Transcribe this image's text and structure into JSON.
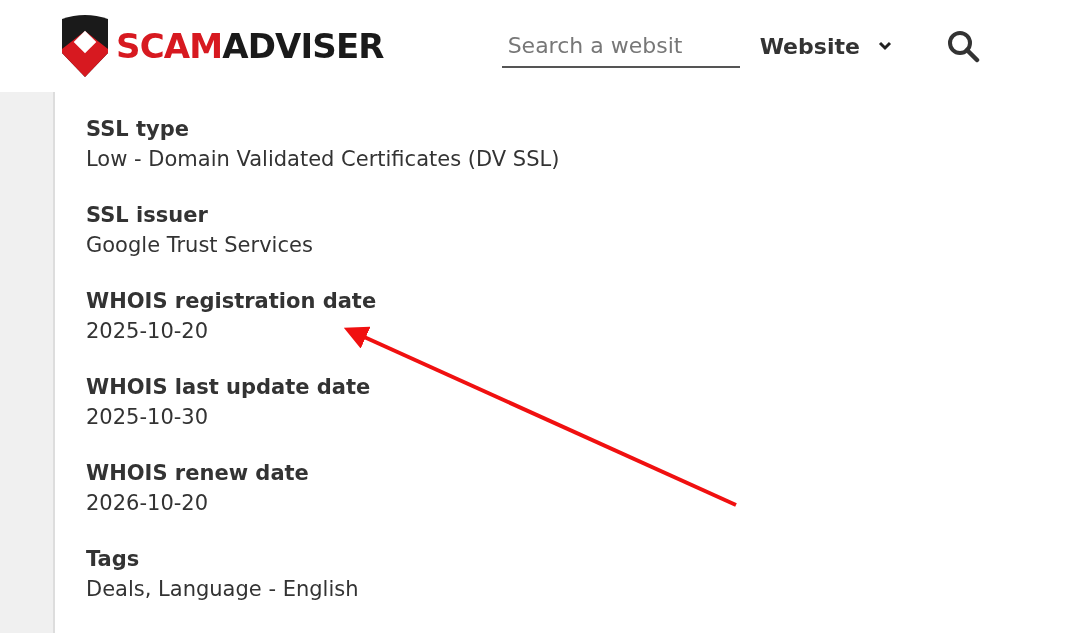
{
  "header": {
    "logo": {
      "part_1": "SCAM",
      "part_2": "ADVISER"
    },
    "search": {
      "placeholder": "Search a websit"
    },
    "search_type": {
      "label": "Website"
    }
  },
  "details": [
    {
      "label": "SSL type",
      "value": "Low - Domain Validated Certificates (DV SSL)"
    },
    {
      "label": "SSL issuer",
      "value": "Google Trust Services"
    },
    {
      "label": "WHOIS registration date",
      "value": "2025-10-20"
    },
    {
      "label": "WHOIS last update date",
      "value": "2025-10-30"
    },
    {
      "label": "WHOIS renew date",
      "value": "2026-10-20"
    },
    {
      "label": "Tags",
      "value": "Deals, Language - English"
    }
  ]
}
